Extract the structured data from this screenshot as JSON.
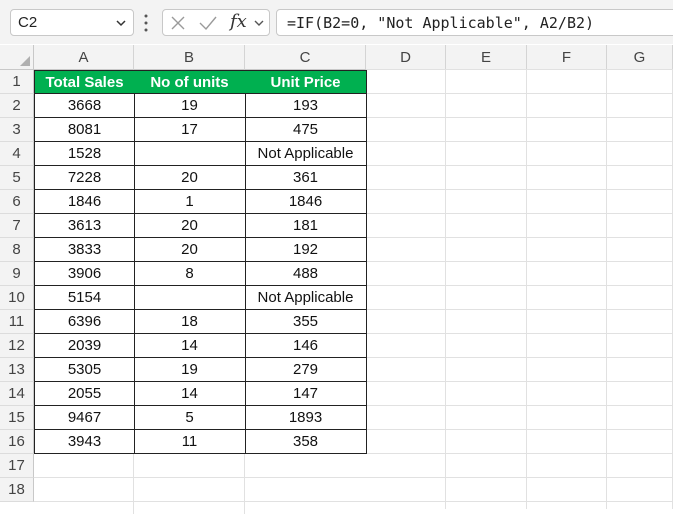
{
  "name_box": {
    "value": "C2"
  },
  "function_icon": "fx",
  "formula_bar": {
    "value": "=IF(B2=0, \"Not Applicable\", A2/B2)"
  },
  "column_headers": [
    "A",
    "B",
    "C",
    "D",
    "E",
    "F",
    "G"
  ],
  "row_numbers": [
    "1",
    "2",
    "3",
    "4",
    "5",
    "6",
    "7",
    "8",
    "9",
    "10",
    "11",
    "12",
    "13",
    "14",
    "15",
    "16",
    "17",
    "18"
  ],
  "table": {
    "headers": [
      "Total Sales",
      "No of units",
      "Unit Price"
    ],
    "rows": [
      [
        "3668",
        "19",
        "193"
      ],
      [
        "8081",
        "17",
        "475"
      ],
      [
        "1528",
        "",
        "Not Applicable"
      ],
      [
        "7228",
        "20",
        "361"
      ],
      [
        "1846",
        "1",
        "1846"
      ],
      [
        "3613",
        "20",
        "181"
      ],
      [
        "3833",
        "20",
        "192"
      ],
      [
        "3906",
        "8",
        "488"
      ],
      [
        "5154",
        "",
        "Not Applicable"
      ],
      [
        "6396",
        "18",
        "355"
      ],
      [
        "2039",
        "14",
        "146"
      ],
      [
        "5305",
        "19",
        "279"
      ],
      [
        "2055",
        "14",
        "147"
      ],
      [
        "9467",
        "5",
        "1893"
      ],
      [
        "3943",
        "11",
        "358"
      ]
    ]
  },
  "colors": {
    "header_fill": "#00b050",
    "header_text": "#ffffff"
  }
}
